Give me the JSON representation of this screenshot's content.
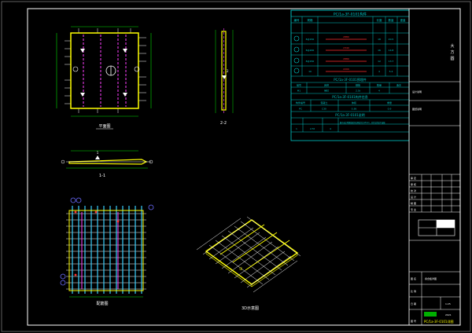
{
  "sheet": {
    "plan_caption": "平面图",
    "section_caption": "1-1",
    "side_caption": "2-2",
    "rebar_caption": "配筋图",
    "iso_caption": "3D示意图",
    "side_mark": "2",
    "section_mark": "1",
    "iso_mark": "①"
  },
  "parts_table": {
    "title": "PC/1a-3F-0101构件",
    "head": [
      "编号",
      "规格",
      "长度",
      "数量",
      "重量"
    ],
    "rows": [
      [
        "①",
        "8@150",
        "2880",
        "18",
        "20.5"
      ],
      [
        "②",
        "8@200",
        "2340",
        "16",
        "14.8"
      ],
      [
        "③",
        "8@150",
        "2880",
        "12",
        "13.7"
      ],
      [
        "④",
        "10",
        "2200",
        "4",
        "5.4"
      ]
    ]
  },
  "embed_table": {
    "title": "PC/1a-3F-0101预埋件",
    "head": [
      "编号",
      "名称",
      "规格",
      "数量",
      "备注"
    ],
    "rows": [
      [
        "M1",
        "吊钉",
        "2.5t",
        "4",
        ""
      ]
    ]
  },
  "summary_table": {
    "title": "PC/1a-3F-0101构件信息",
    "head": [
      "构件编号",
      "混凝土",
      "体积",
      "重量"
    ],
    "rows": [
      [
        "PC",
        "C30",
        "0.36",
        "0.9"
      ]
    ]
  },
  "notes_table": {
    "title": "PC/1a-3F-0101说明",
    "row": [
      "1",
      "2.5t",
      "4",
      "图中未注明钢筋保护层厚度均为15mm，吊钉位置见平面图"
    ]
  },
  "title_block": {
    "company": "大\n方\n圆",
    "project_label": "设计说明",
    "project_value": "图纸说明",
    "sign_rows": [
      "审 定",
      "审 核",
      "校 对",
      "设 计",
      "制 图",
      "专 业"
    ],
    "drawing_name_label": "图 名",
    "drawing_name": "叠合板详图",
    "scale_label": "比 例",
    "scale_value": "1:25",
    "date_label": "日 期",
    "date_value": "2021",
    "number_label": "图 号",
    "number_value": "PC/1a-3F-0101详图"
  },
  "colors": {
    "frame": "#ffffff",
    "table": "#00c8c8",
    "outline": "#ffff00",
    "rebar": "#3ad0ff",
    "dim": "#00e000",
    "red": "#ff3030",
    "magenta": "#ff40ff"
  }
}
